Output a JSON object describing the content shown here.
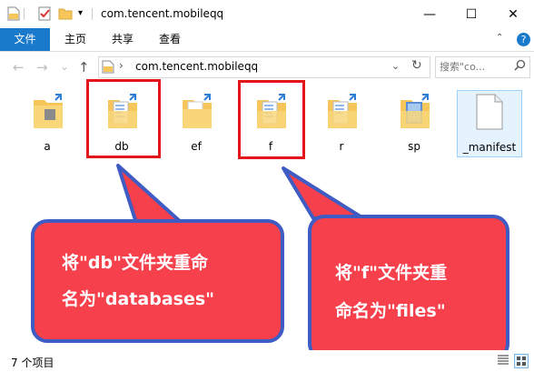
{
  "window": {
    "title": "com.tencent.mobileqq",
    "controls": {
      "minimize": "—",
      "maximize": "☐",
      "close": "✕"
    }
  },
  "ribbon": {
    "tabs": [
      {
        "label": "文件"
      },
      {
        "label": "主页"
      },
      {
        "label": "共享"
      },
      {
        "label": "查看"
      }
    ],
    "help": "?"
  },
  "nav": {
    "back": "←",
    "forward": "→",
    "recent": "⌄",
    "up": "↑"
  },
  "address": {
    "separator": "›",
    "path": "com.tencent.mobileqq"
  },
  "search": {
    "placeholder": "搜索\"co..."
  },
  "items": [
    {
      "label": "a"
    },
    {
      "label": "db"
    },
    {
      "label": "ef"
    },
    {
      "label": "f"
    },
    {
      "label": "r"
    },
    {
      "label": "sp"
    },
    {
      "label": "_manifest"
    }
  ],
  "callouts": {
    "left": {
      "line1": "将\"db\"文件夹重命",
      "line2": "名为\"databases\""
    },
    "right": {
      "line1": "将\"f\"文件夹重",
      "line2": "命名为\"files\""
    }
  },
  "status": {
    "count": "7 个项目"
  },
  "colors": {
    "accent": "#1979ca",
    "highlight": "#e4141b",
    "callout_fill": "#f6404b",
    "callout_border": "#3f5bc4",
    "folder": "#f6c65b"
  }
}
